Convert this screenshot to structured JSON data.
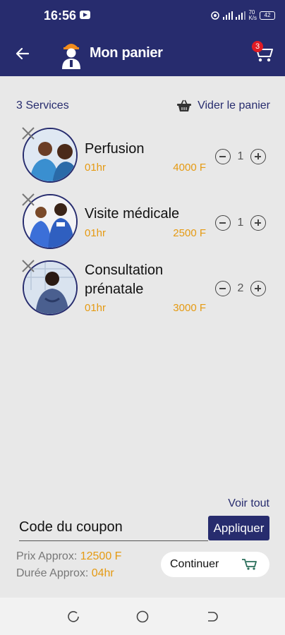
{
  "status": {
    "time": "16:56",
    "net": "70\nK/s",
    "battery": "42"
  },
  "header": {
    "title": "Mon panier",
    "cart_count": "3"
  },
  "summary": {
    "services_count": "3 Services",
    "clear_label": "Vider le panier"
  },
  "items": [
    {
      "name": "Perfusion",
      "duration": "01hr",
      "price": "4000 F",
      "qty": "1"
    },
    {
      "name": "Visite médicale",
      "duration": "01hr",
      "price": "2500 F",
      "qty": "1"
    },
    {
      "name": "Consultation prénatale",
      "duration": "01hr",
      "price": "3000 F",
      "qty": "2"
    }
  ],
  "footer": {
    "voir_tout": "Voir tout",
    "coupon_label": "Code du coupon",
    "apply_label": "Appliquer",
    "price_label": "Prix Approx:",
    "price_value": "12500 F",
    "duration_label": "Durée Approx:",
    "duration_value": "04hr",
    "continue_label": "Continuer"
  },
  "colors": {
    "primary": "#272c6e",
    "accent": "#e59a12",
    "background": "#e8e8e8"
  },
  "icons": [
    "back-arrow-icon",
    "nurse-logo-icon",
    "cart-icon",
    "basket-icon",
    "remove-icon",
    "minus-icon",
    "plus-icon"
  ]
}
